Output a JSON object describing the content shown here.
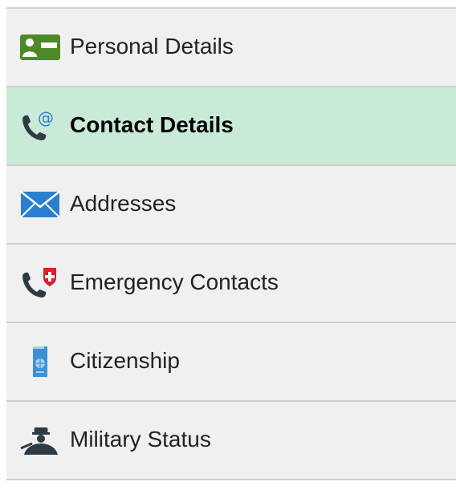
{
  "nav": {
    "items": [
      {
        "label": "Personal Details",
        "icon": "id-card-icon",
        "selected": false
      },
      {
        "label": "Contact Details",
        "icon": "phone-at-icon",
        "selected": true
      },
      {
        "label": "Addresses",
        "icon": "envelope-icon",
        "selected": false
      },
      {
        "label": "Emergency Contacts",
        "icon": "phone-medical-icon",
        "selected": false
      },
      {
        "label": "Citizenship",
        "icon": "passport-icon",
        "selected": false
      },
      {
        "label": "Military Status",
        "icon": "soldier-icon",
        "selected": false
      }
    ]
  },
  "colors": {
    "background": "#f0f0f0",
    "selected_background": "#c9ead7",
    "divider": "#cfcfcf",
    "id_card_green": "#4d8a27",
    "envelope_blue": "#2a7fd1",
    "medical_red": "#d8202a",
    "passport_blue": "#3d8fd6",
    "icon_dark": "#2e3a44"
  }
}
